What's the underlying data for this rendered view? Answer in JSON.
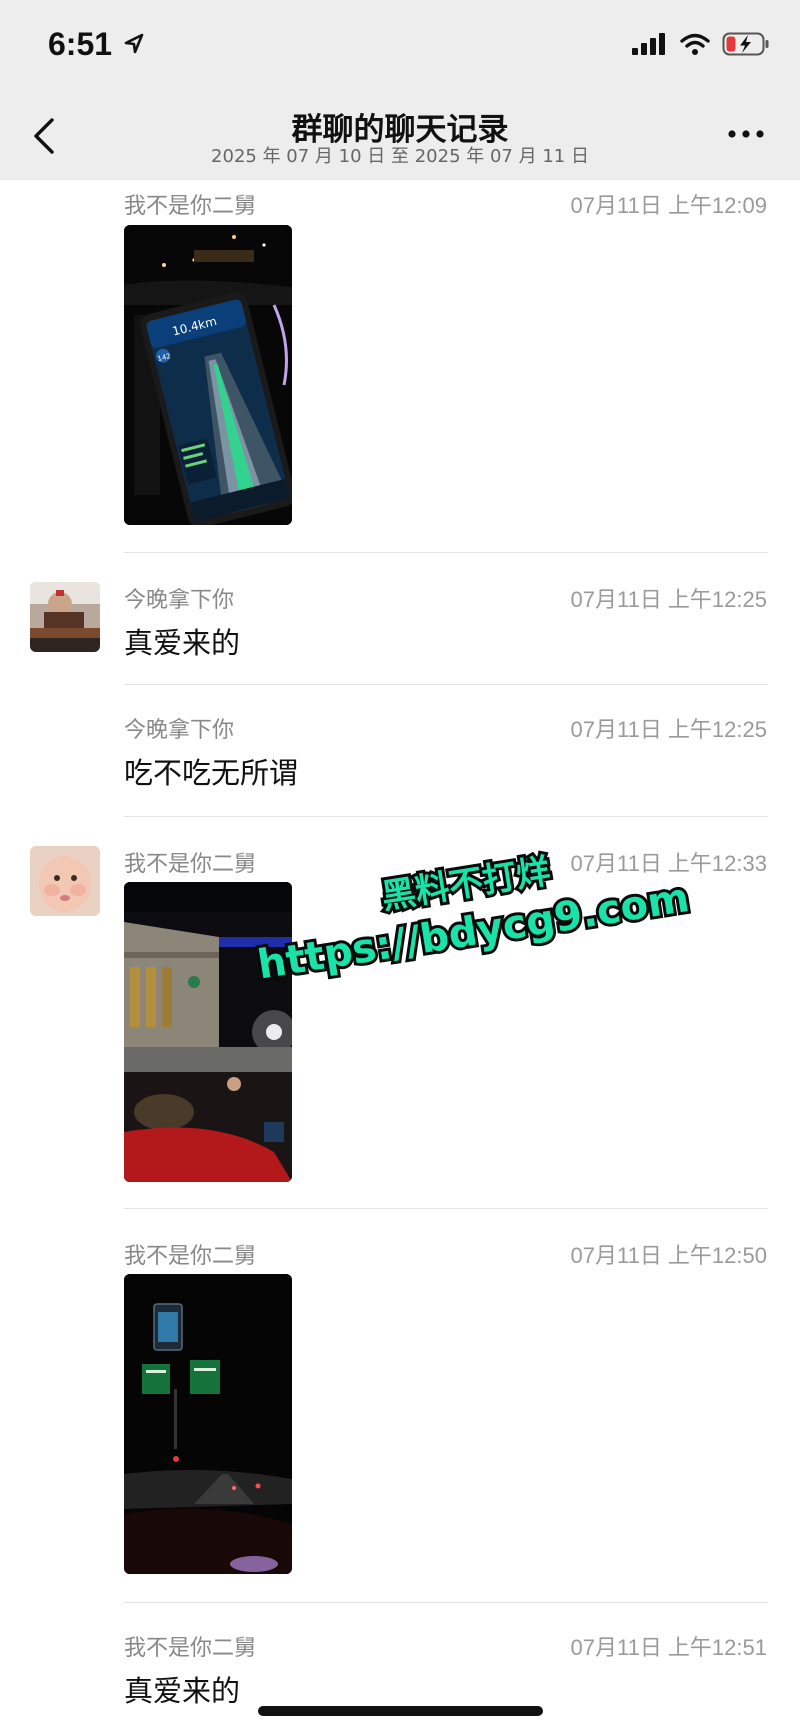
{
  "status_bar": {
    "time": "6:51"
  },
  "header": {
    "title": "群聊的聊天记录",
    "subtitle": "2025 年 07 月 10 日 至 2025 年 07 月 11 日"
  },
  "messages": [
    {
      "sender": "我不是你二舅",
      "time": "07月11日 上午12:09",
      "type": "image"
    },
    {
      "sender": "今晚拿下你",
      "time": "07月11日 上午12:25",
      "text": "真爱来的"
    },
    {
      "sender": "今晚拿下你",
      "time": "07月11日 上午12:25",
      "text": "吃不吃无所谓"
    },
    {
      "sender": "我不是你二舅",
      "time": "07月11日 上午12:33",
      "type": "image"
    },
    {
      "sender": "我不是你二舅",
      "time": "07月11日 上午12:50",
      "type": "image"
    },
    {
      "sender": "我不是你二舅",
      "time": "07月11日 上午12:51",
      "text": "真爱来的"
    }
  ],
  "watermark": {
    "line1": "黑料不打烊",
    "line2": "https://bdycg9.com"
  },
  "phone_screen": {
    "distance": "10.4km",
    "speed": "142"
  },
  "icons": [
    "location-arrow-icon",
    "signal-icon",
    "wifi-icon",
    "battery-icon",
    "back-chevron-icon",
    "more-icon"
  ],
  "colors": {
    "bar_bg": "#ededed",
    "watermark_fill": "#19e3a9",
    "battery_red": "#e5393b"
  }
}
